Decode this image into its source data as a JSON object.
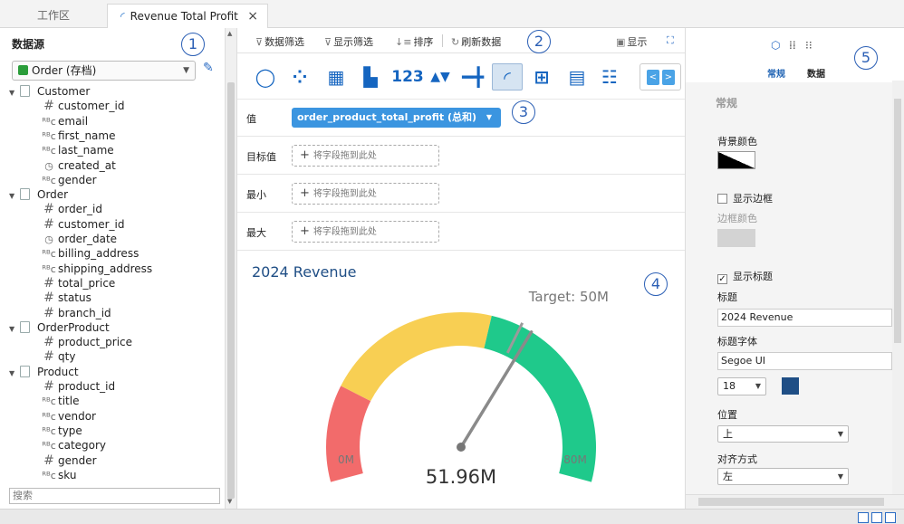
{
  "tabs": {
    "workspace": "工作区",
    "active": "Revenue Total Profit",
    "close": "×"
  },
  "left": {
    "title": "数据源",
    "datasource": "Order (存档)",
    "search_placeholder": "搜索",
    "tree": [
      {
        "type": "table",
        "label": "Customer"
      },
      {
        "type": "num",
        "label": "customer_id"
      },
      {
        "type": "str",
        "label": "email"
      },
      {
        "type": "str",
        "label": "first_name"
      },
      {
        "type": "str",
        "label": "last_name"
      },
      {
        "type": "date",
        "label": "created_at"
      },
      {
        "type": "str",
        "label": "gender"
      },
      {
        "type": "table",
        "label": "Order"
      },
      {
        "type": "num",
        "label": "order_id"
      },
      {
        "type": "num",
        "label": "customer_id"
      },
      {
        "type": "date",
        "label": "order_date"
      },
      {
        "type": "str",
        "label": "billing_address"
      },
      {
        "type": "str",
        "label": "shipping_address"
      },
      {
        "type": "num",
        "label": "total_price"
      },
      {
        "type": "num",
        "label": "status"
      },
      {
        "type": "num",
        "label": "branch_id"
      },
      {
        "type": "table",
        "label": "OrderProduct"
      },
      {
        "type": "num",
        "label": "product_price"
      },
      {
        "type": "num",
        "label": "qty"
      },
      {
        "type": "table",
        "label": "Product"
      },
      {
        "type": "num",
        "label": "product_id"
      },
      {
        "type": "str",
        "label": "title"
      },
      {
        "type": "str",
        "label": "vendor"
      },
      {
        "type": "str",
        "label": "type"
      },
      {
        "type": "str",
        "label": "category"
      },
      {
        "type": "num",
        "label": "gender"
      },
      {
        "type": "str",
        "label": "sku"
      }
    ]
  },
  "markers": [
    "1",
    "2",
    "3",
    "4",
    "5"
  ],
  "toolbar": {
    "data_filter": "数据筛选",
    "display_filter": "显示筛选",
    "sort": "排序",
    "refresh": "刷新数据",
    "show": "显示"
  },
  "fields": {
    "value_label": "值",
    "value_pill": "order_product_total_profit (总和)",
    "target_label": "目标值",
    "min_label": "最小",
    "max_label": "最大",
    "drop_hint": "将字段拖到此处"
  },
  "chart": {
    "title": "2024 Revenue",
    "target_text": "Target: 50M",
    "min_label": "0M",
    "max_label": "80M",
    "value_text": "51.96M",
    "colors": {
      "red": "#f26b6b",
      "yellow": "#f8cf53",
      "green": "#1fc98b",
      "needle": "#8a8a8a"
    }
  },
  "chart_data": {
    "type": "gauge",
    "title": "2024 Revenue",
    "min": 0,
    "max": 80,
    "value": 51.96,
    "target": 50,
    "unit": "M",
    "bands": [
      {
        "from": 0,
        "to": 16,
        "color": "#f26b6b"
      },
      {
        "from": 16,
        "to": 45,
        "color": "#f8cf53"
      },
      {
        "from": 45,
        "to": 80,
        "color": "#1fc98b"
      }
    ]
  },
  "right": {
    "tab_general": "常规",
    "tab_data": "数据",
    "section": "常规",
    "bg_color_label": "背景颜色",
    "show_border": "显示边框",
    "border_color": "边框颜色",
    "show_title": "显示标题",
    "title_label": "标题",
    "title_value": "2024 Revenue",
    "title_font_label": "标题字体",
    "font_value": "Segoe UI",
    "font_size": "18",
    "title_color": "#1f4e85",
    "position_label": "位置",
    "position_value": "上",
    "align_label": "对齐方式",
    "align_value": "左"
  }
}
